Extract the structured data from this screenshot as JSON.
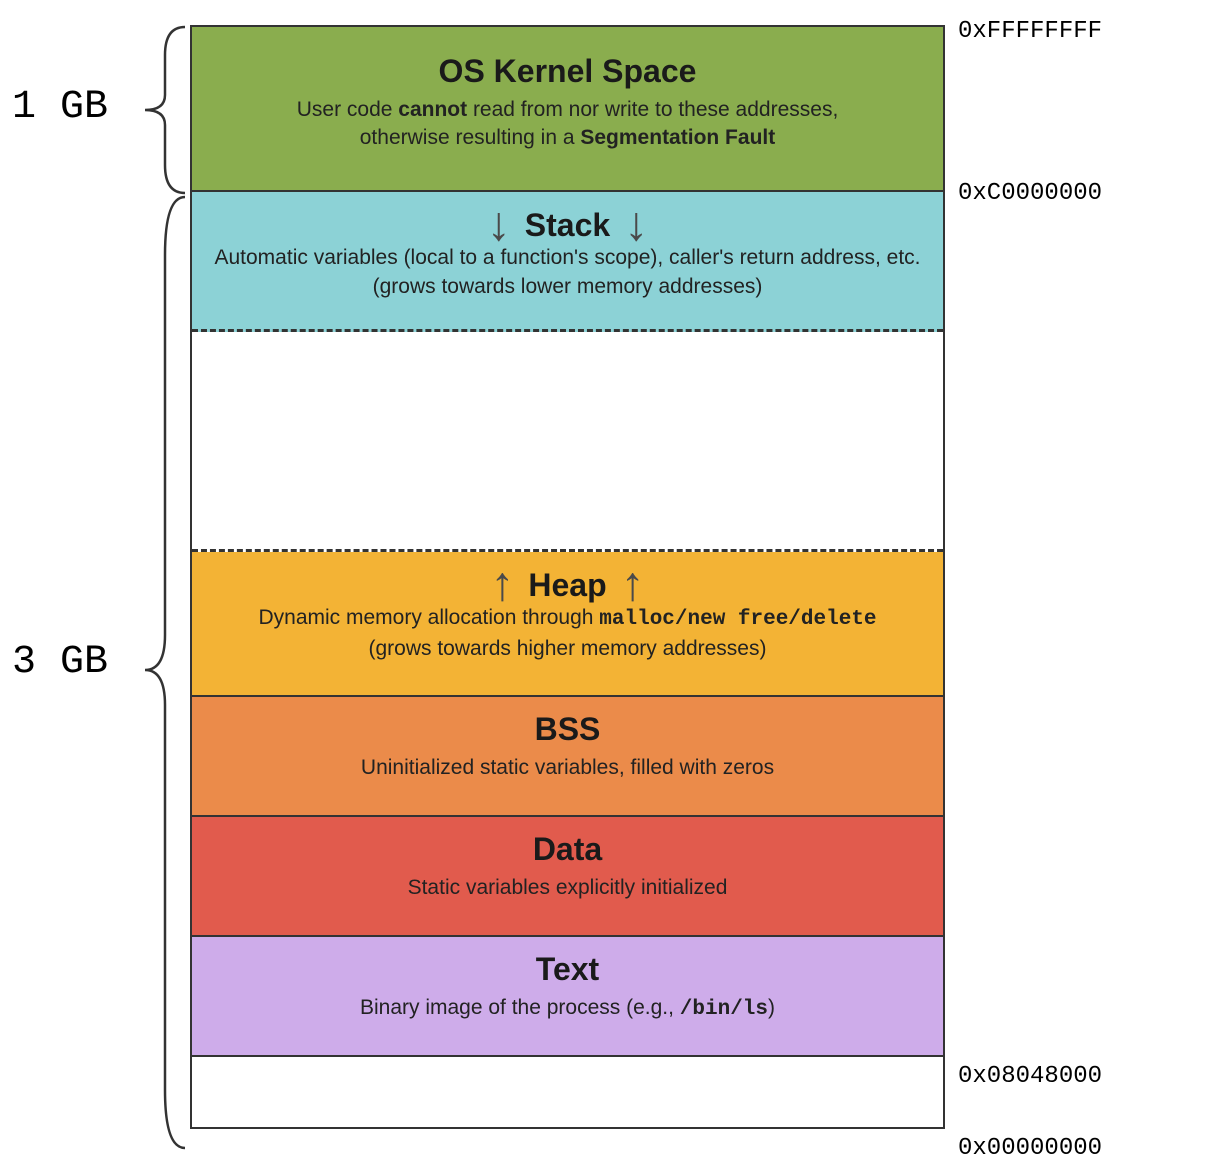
{
  "sizes": {
    "kernel_gb": "1 GB",
    "user_gb": "3 GB"
  },
  "addresses": {
    "top": "0xFFFFFFFF",
    "kernel_base": "0xC0000000",
    "text_base": "0x08048000",
    "bottom": "0x00000000"
  },
  "segments": {
    "kernel": {
      "title": "OS Kernel Space",
      "desc_pre": "User code ",
      "desc_bold1": "cannot",
      "desc_mid": " read from nor write to these addresses,\notherwise resulting in a ",
      "desc_bold2": "Segmentation Fault"
    },
    "stack": {
      "title": "Stack",
      "desc_line1": "Automatic variables (local to a function's scope), caller's return address, etc.",
      "desc_line2": "(grows towards lower memory addresses)"
    },
    "heap": {
      "title": "Heap",
      "desc_pre": "Dynamic memory allocation through ",
      "desc_mono": "malloc/new free/delete",
      "desc_line2": "(grows towards higher memory addresses)"
    },
    "bss": {
      "title": "BSS",
      "desc": "Uninitialized static variables, filled with zeros"
    },
    "data": {
      "title": "Data",
      "desc": "Static variables explicitly initialized"
    },
    "text": {
      "title": "Text",
      "desc_pre": "Binary image of the process (e.g., ",
      "desc_mono": "/bin/ls",
      "desc_post": ")"
    }
  }
}
